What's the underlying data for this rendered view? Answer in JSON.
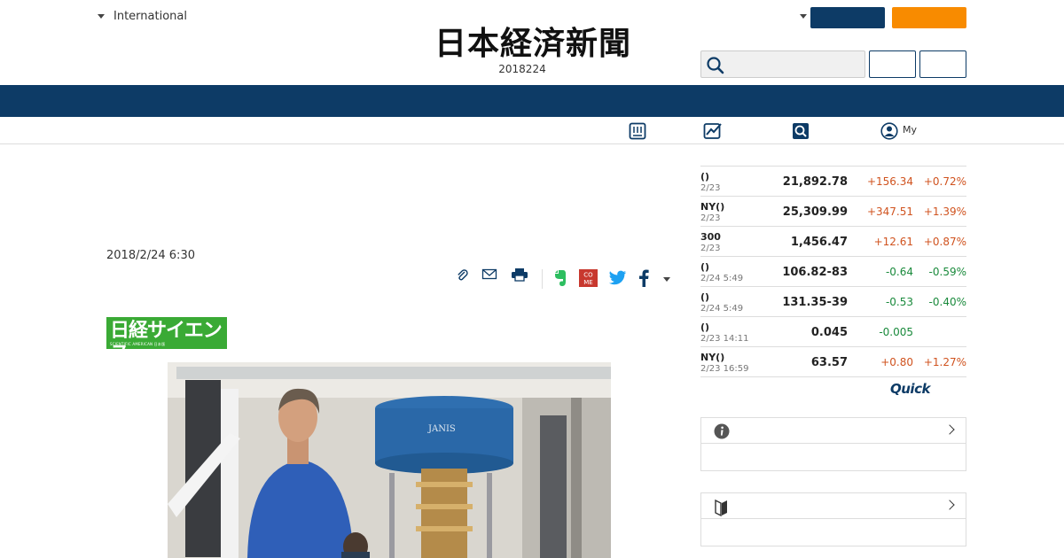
{
  "header": {
    "edition_label": "International",
    "logo_text": "日本経済新聞",
    "date_line": "2018224",
    "search": {
      "placeholder": ""
    }
  },
  "subnav": {
    "my_label": "My",
    "icons": [
      "newspaper-icon",
      "chart-icon",
      "search-icon",
      "account-icon"
    ]
  },
  "article": {
    "date": "2018/2/24 6:30",
    "section_logo": {
      "main_text": "日経サイエンス",
      "sub_text": "SCIENTIFIC AMERICAN 日本版"
    },
    "photo_caption_text": "JANIS",
    "share_icons": [
      "clip-icon",
      "mail-icon",
      "print-icon",
      "evernote-icon",
      "come-icon",
      "twitter-icon",
      "facebook-icon",
      "more-icon"
    ],
    "come_label": "CO\nME"
  },
  "market": {
    "rows": [
      {
        "name": "()",
        "time": "2/23",
        "price": "21,892.78",
        "change": "+156.34",
        "pct": "+0.72%",
        "dir": "up"
      },
      {
        "name": "NY()",
        "time": "2/23",
        "price": "25,309.99",
        "change": "+347.51",
        "pct": "+1.39%",
        "dir": "up"
      },
      {
        "name": "300",
        "time": "2/23",
        "price": "1,456.47",
        "change": "+12.61",
        "pct": "+0.87%",
        "dir": "up"
      },
      {
        "name": "()",
        "time": "2/24 5:49",
        "price": "106.82-83",
        "change": "-0.64",
        "pct": "-0.59%",
        "dir": "down"
      },
      {
        "name": "()",
        "time": "2/24 5:49",
        "price": "131.35-39",
        "change": "-0.53",
        "pct": "-0.40%",
        "dir": "down"
      },
      {
        "name": "()",
        "time": "2/23 14:11",
        "price": "0.045",
        "change": "-0.005",
        "pct": "",
        "dir": "down"
      },
      {
        "name": "NY()",
        "time": "2/23 16:59",
        "price": "63.57",
        "change": "+0.80",
        "pct": "+1.27%",
        "dir": "up"
      }
    ],
    "quick_logo": "Quick"
  },
  "colors": {
    "navy": "#0d3b66",
    "orange": "#f88b00",
    "up": "#d0531f",
    "down": "#1a8a3c",
    "science_green": "#3aaa35"
  }
}
